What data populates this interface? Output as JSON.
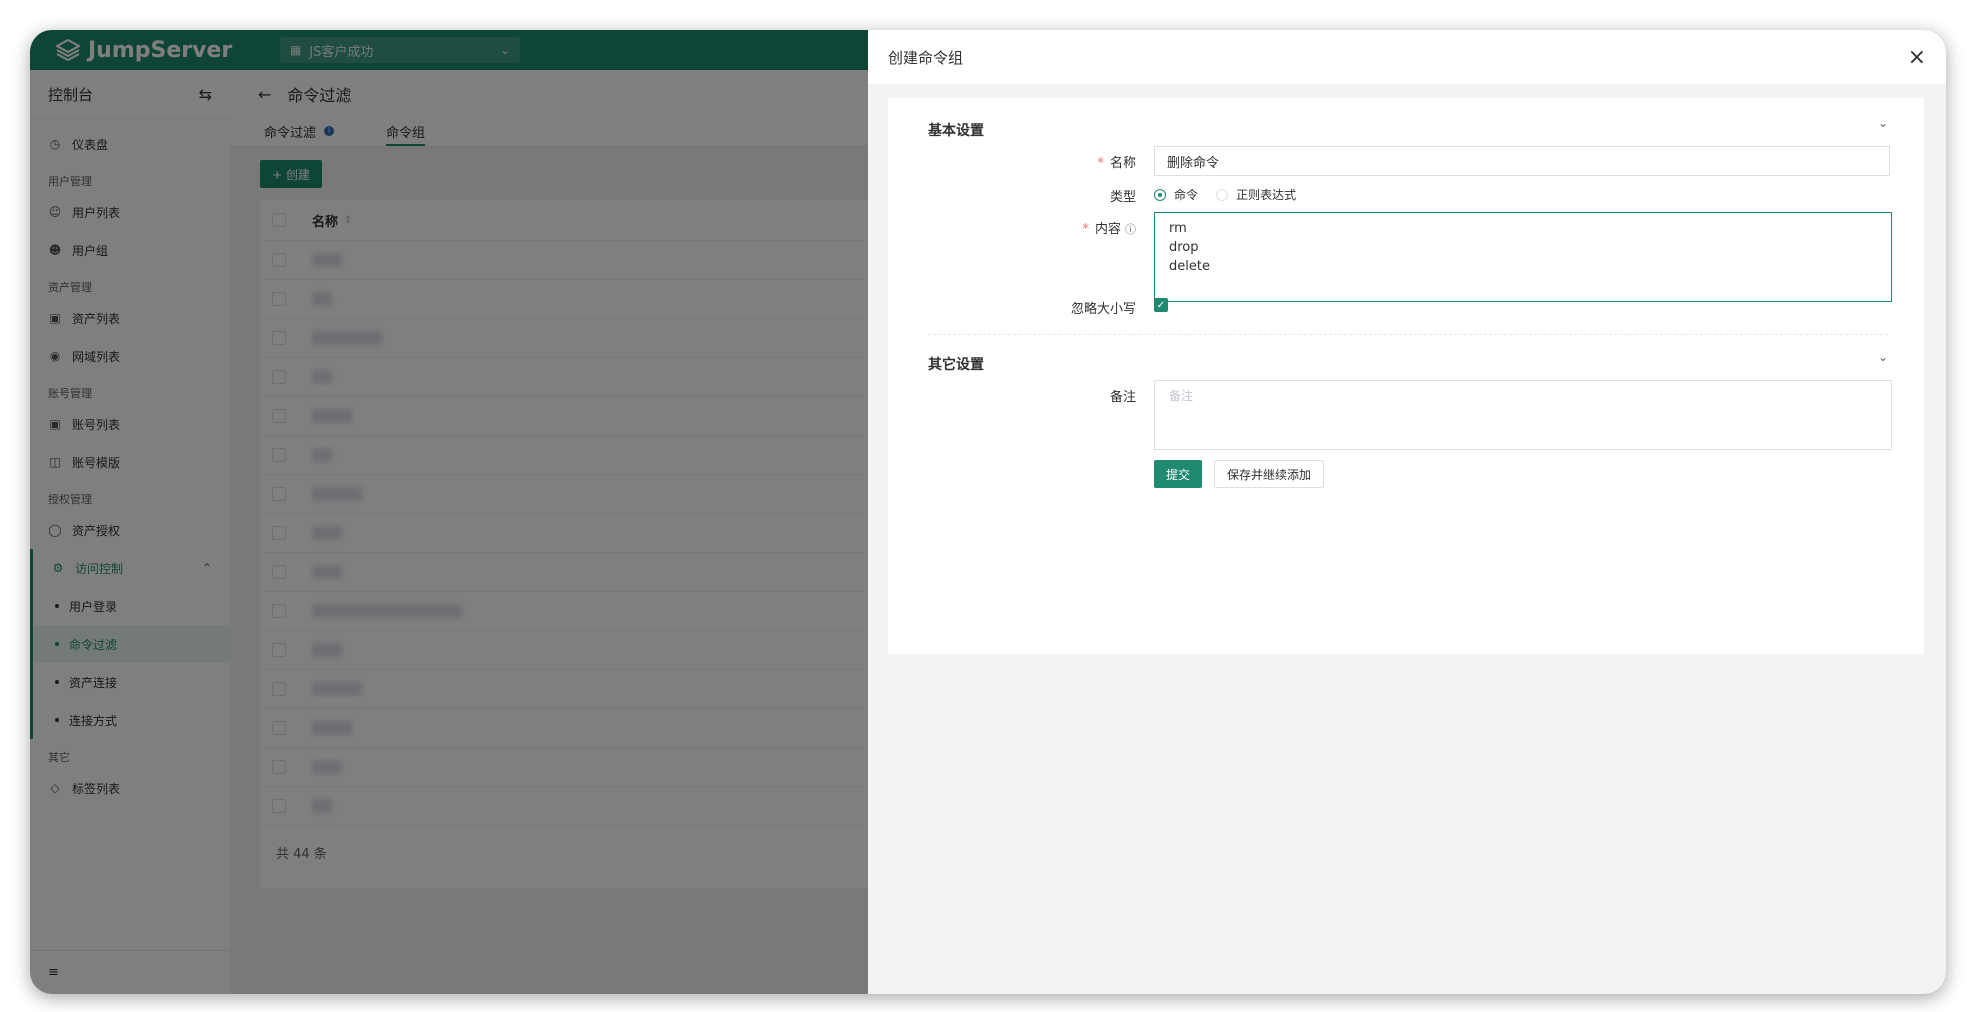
{
  "app": {
    "brand": "JumpServer",
    "org_selector": "JS客户成功"
  },
  "sidebar": {
    "title": "控制台",
    "dashboard": "仪表盘",
    "groups": {
      "user_mgmt": "用户管理",
      "asset_mgmt": "资产管理",
      "account_mgmt": "账号管理",
      "perm_mgmt": "授权管理",
      "other": "其它"
    },
    "items": {
      "user_list": "用户列表",
      "user_group": "用户组",
      "asset_list": "资产列表",
      "zone_list": "网域列表",
      "account_list": "账号列表",
      "account_template": "账号模版",
      "asset_perm": "资产授权",
      "access_control": "访问控制",
      "user_login": "用户登录",
      "cmd_filter": "命令过滤",
      "asset_connect": "资产连接",
      "connect_method": "连接方式",
      "tag_list": "标签列表"
    }
  },
  "page": {
    "title": "命令过滤",
    "tabs": [
      "命令过滤",
      "命令组"
    ],
    "create_button": "+ 创建",
    "column_name": "名称",
    "total": "共 44 条"
  },
  "drawer": {
    "title": "创建命令组",
    "basic_section": "基本设置",
    "other_section": "其它设置",
    "name_label": "名称",
    "name_value": "删除命令",
    "type_label": "类型",
    "type_options": [
      "命令",
      "正则表达式"
    ],
    "type_selected": "命令",
    "content_label": "内容",
    "content_value": "rm\ndrop\ndelete",
    "ignore_case_label": "忽略大小写",
    "ignore_case_checked": true,
    "comment_label": "备注",
    "comment_placeholder": "备注",
    "submit": "提交",
    "save_continue": "保存并继续添加"
  },
  "colors": {
    "brand": "#1f8a6f",
    "required": "#f56c6c"
  }
}
